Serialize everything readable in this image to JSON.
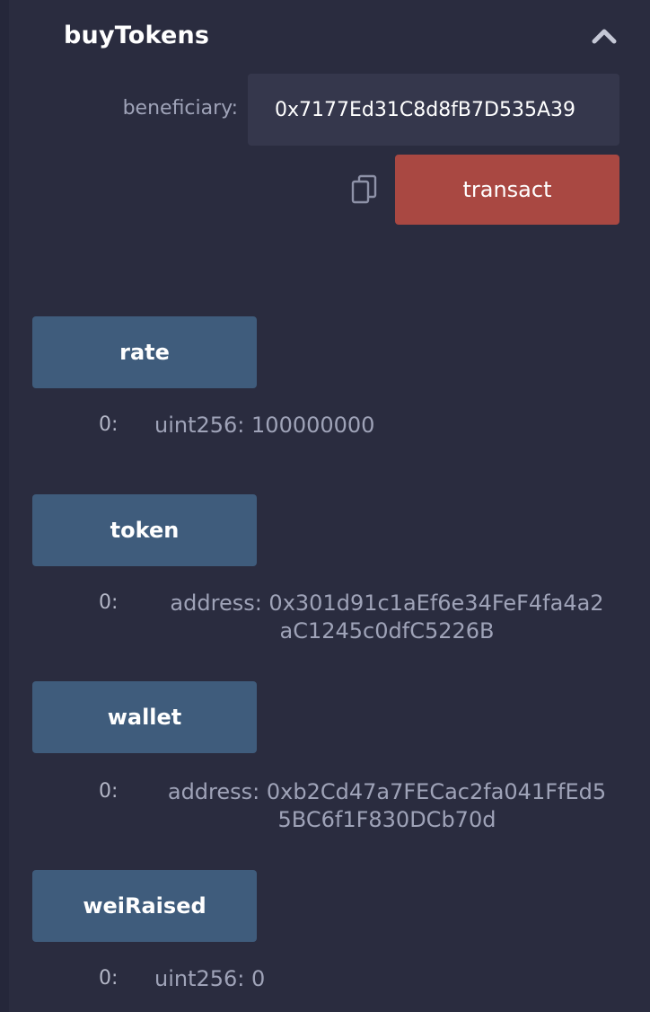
{
  "buy_tokens": {
    "title": "buyTokens",
    "collapse_icon": "chevron-up-icon",
    "beneficiary_label": "beneficiary:",
    "beneficiary_value": "0x7177Ed31C8d8fB7D535A39",
    "copy_icon": "clipboard-copy-icon",
    "transact_label": "transact",
    "transact_color": "#a94842"
  },
  "calls": [
    {
      "button_label": "rate",
      "output_index": "0:",
      "output_value": "uint256: 100000000"
    },
    {
      "button_label": "token",
      "output_index": "0:",
      "output_value_line1": "address: 0x301d91c1aEf6e34FeF4fa4a2",
      "output_value_line2": "aC1245c0dfC5226B"
    },
    {
      "button_label": "wallet",
      "output_index": "0:",
      "output_value_line1": "address: 0xb2Cd47a7FECac2fa041FfEd5",
      "output_value_line2": "5BC6f1F830DCb70d"
    },
    {
      "button_label": "weiRaised",
      "output_index": "0:",
      "output_value": "uint256: 0"
    }
  ],
  "colors": {
    "background": "#2a2c3f",
    "call_button": "#3f5c7c",
    "input_background": "#35374c"
  }
}
